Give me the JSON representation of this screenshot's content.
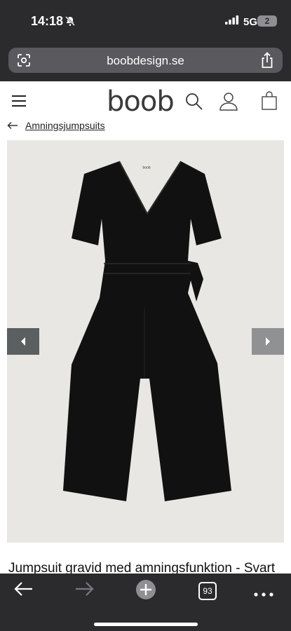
{
  "status": {
    "time": "14:18",
    "network": "5G",
    "battery": "2"
  },
  "browser": {
    "url": "boobdesign.se",
    "tabs_count": "93"
  },
  "site": {
    "logo": "boob",
    "breadcrumb": "Amningsjumpsuits"
  },
  "product": {
    "title": "Jumpsuit gravid med amningsfunktion - Svart",
    "label_tag": "boob"
  },
  "colors": {
    "chrome": "#2b2b2e",
    "urlbar": "#5a5a5e",
    "gallery_bg": "#e8e7e3",
    "garment": "#111111"
  }
}
